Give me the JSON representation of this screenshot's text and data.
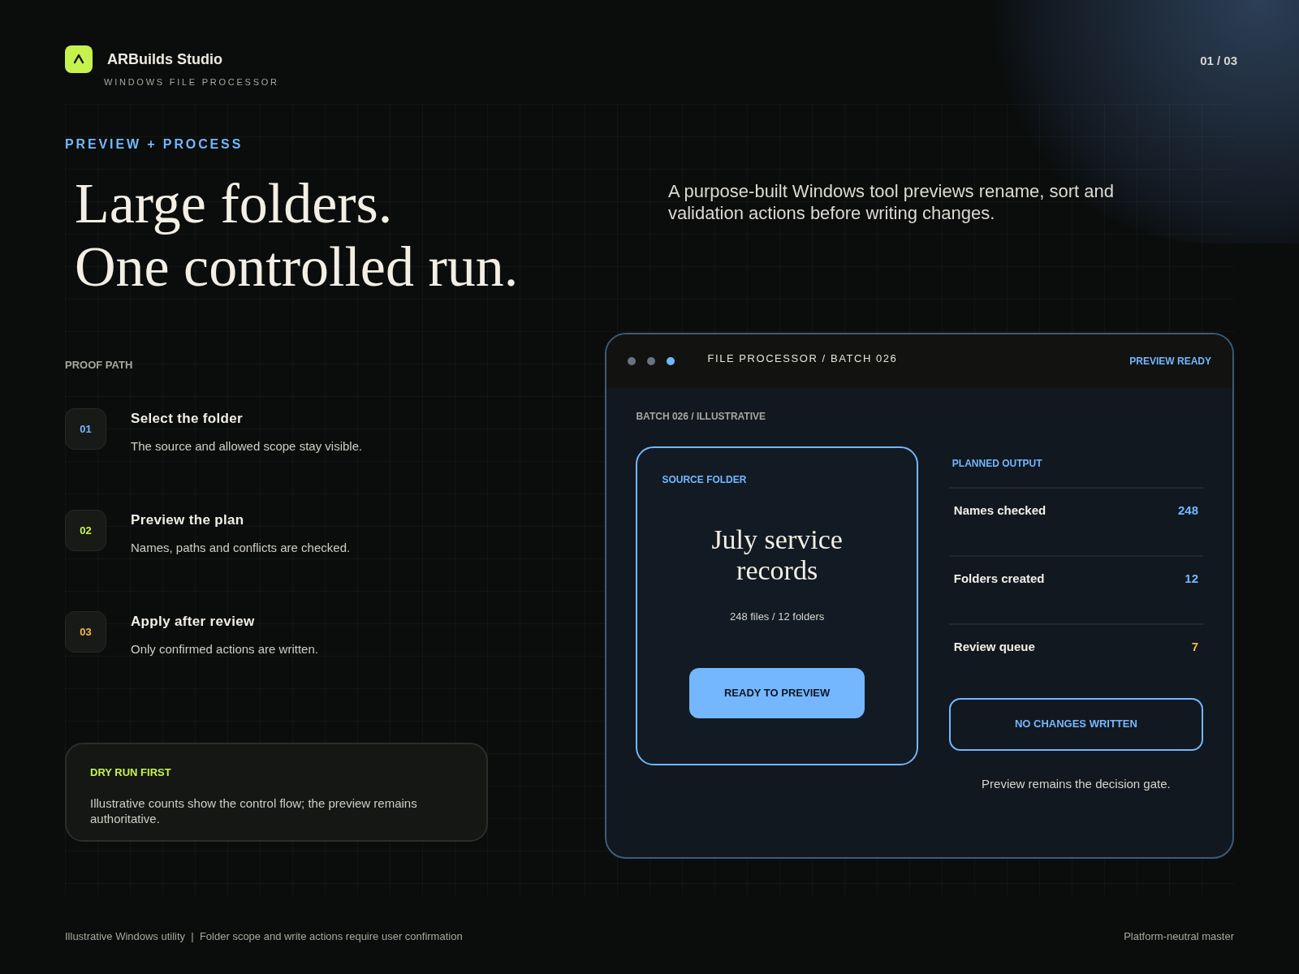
{
  "brand": {
    "name": "ARBuilds Studio",
    "subtitle": "WINDOWS FILE PROCESSOR",
    "page": "01 / 03"
  },
  "hero": {
    "eyebrow": "PREVIEW + PROCESS",
    "headline": [
      "Large folders.",
      "One controlled run."
    ],
    "description": "A purpose-built Windows tool previews rename, sort and validation actions before writing changes."
  },
  "proof_path": {
    "label": "PROOF PATH",
    "steps": [
      {
        "number": "01",
        "color": "#74b7ff",
        "title": "Select the folder",
        "text": "The source and allowed scope stay visible."
      },
      {
        "number": "02",
        "color": "#c6f24e",
        "title": "Preview the plan",
        "text": "Names, paths and conflicts are checked."
      },
      {
        "number": "03",
        "color": "#f5b74a",
        "title": "Apply after review",
        "text": "Only confirmed actions are written."
      }
    ]
  },
  "note": {
    "title": "DRY RUN FIRST",
    "text": "Illustrative counts show the control flow; the preview remains authoritative."
  },
  "window": {
    "dots": [
      {
        "color": "#6b7280"
      },
      {
        "color": "#6b7280"
      },
      {
        "color": "#74b7ff"
      }
    ],
    "title": "FILE PROCESSOR / BATCH 026",
    "status": "PREVIEW READY",
    "batch_label": "BATCH 026 / ILLUSTRATIVE",
    "source": {
      "label": "SOURCE FOLDER",
      "name": "July service records",
      "summary": "248 files / 12 folders",
      "button": "READY TO PREVIEW"
    },
    "planned": {
      "label": "PLANNED OUTPUT",
      "rows": [
        {
          "label": "Names checked",
          "value": "248",
          "color": "#74b7ff"
        },
        {
          "label": "Folders created",
          "value": "12",
          "color": "#74b7ff"
        },
        {
          "label": "Review queue",
          "value": "7",
          "color": "#f5b74a"
        }
      ],
      "button": "NO CHANGES WRITTEN",
      "caption": "Preview remains the decision gate."
    }
  },
  "footer": {
    "left": "Illustrative Windows utility  |  Folder scope and write actions require user confirmation",
    "right": "Platform-neutral master"
  }
}
